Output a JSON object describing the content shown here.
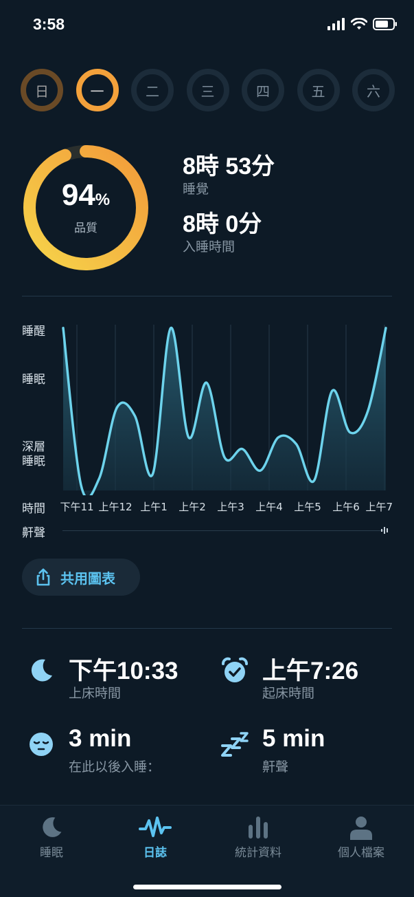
{
  "status": {
    "time": "3:58"
  },
  "days": [
    "日",
    "一",
    "二",
    "三",
    "四",
    "五",
    "六"
  ],
  "quality": {
    "value": "94",
    "unit": "%",
    "label": "品質",
    "fraction": 0.94
  },
  "summary": {
    "sleep_value": "8時 53分",
    "sleep_label": "睡覺",
    "asleep_value": "8時 0分",
    "asleep_label": "入睡時間"
  },
  "chart_data": {
    "type": "line",
    "y_levels": [
      "睡醒",
      "睡眠",
      "深層睡眠"
    ],
    "x_label": "時間",
    "x_ticks": [
      "下午11",
      "上午12",
      "上午1",
      "上午2",
      "上午3",
      "上午4",
      "上午5",
      "上午6",
      "上午7"
    ],
    "snore_label": "鼾聲",
    "ylim": [
      0,
      1
    ],
    "series": [
      {
        "values": [
          0.98,
          0.03,
          0.07,
          0.5,
          0.45,
          0.1,
          0.98,
          0.32,
          0.65,
          0.2,
          0.25,
          0.12,
          0.32,
          0.28,
          0.06,
          0.6,
          0.35,
          0.48,
          0.98
        ]
      }
    ]
  },
  "share": {
    "label": "共用圖表"
  },
  "stats": {
    "bedtime_value": "下午10:33",
    "bedtime_label": "上床時間",
    "wake_value": "上午7:26",
    "wake_label": "起床時間",
    "fallasleep_value": "3 min",
    "fallasleep_label": "在此以後入睡：",
    "snore_value": "5 min",
    "snore_label": "鼾聲"
  },
  "tabs": [
    {
      "label": "睡眠"
    },
    {
      "label": "日誌"
    },
    {
      "label": "統計資料"
    },
    {
      "label": "個人檔案"
    }
  ],
  "colors": {
    "accent": "#5cc3f0",
    "ring_start": "#f6d44a",
    "ring_end": "#f29a3a",
    "background": "#0d1a26"
  }
}
